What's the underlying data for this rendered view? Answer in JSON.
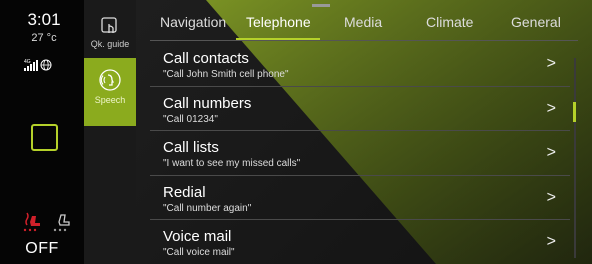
{
  "status": {
    "time": "3:01",
    "temperature": "27 °c",
    "network": "4G",
    "off_label": "OFF"
  },
  "modes": {
    "quick_guide": "Qk. guide",
    "speech": "Speech"
  },
  "tabs": [
    {
      "label": "Navigation",
      "active": false
    },
    {
      "label": "Telephone",
      "active": true
    },
    {
      "label": "Media",
      "active": false
    },
    {
      "label": "Climate",
      "active": false
    },
    {
      "label": "General",
      "active": false
    }
  ],
  "items": [
    {
      "title": "Call contacts",
      "subtitle": "\"Call John Smith cell phone\"",
      "chevron": ">"
    },
    {
      "title": "Call numbers",
      "subtitle": "\"Call 01234\"",
      "chevron": ">"
    },
    {
      "title": "Call lists",
      "subtitle": "\"I want to see my missed calls\"",
      "chevron": ">"
    },
    {
      "title": "Redial",
      "subtitle": "\"Call number again\"",
      "chevron": ">"
    },
    {
      "title": "Voice mail",
      "subtitle": "\"Call voice mail\"",
      "chevron": ">"
    }
  ],
  "colors": {
    "accent": "#b5d12a",
    "speech_active": "#8bab1e",
    "seat_heat": "#d0202a"
  }
}
